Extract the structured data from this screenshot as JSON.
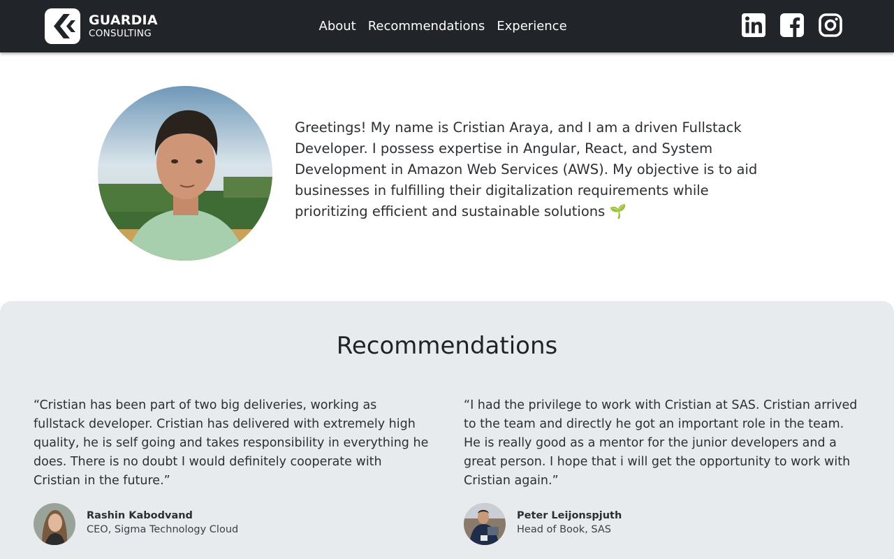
{
  "header": {
    "brand": {
      "line1": "GUARDIA",
      "line2": "CONSULTING"
    },
    "nav": [
      {
        "label": "About"
      },
      {
        "label": "Recommendations"
      },
      {
        "label": "Experience"
      }
    ],
    "socials": [
      {
        "icon": "linkedin-icon"
      },
      {
        "icon": "facebook-icon"
      },
      {
        "icon": "instagram-icon"
      }
    ]
  },
  "about": {
    "intro": "Greetings! My name is Cristian Araya, and I am a driven Fullstack Developer. I possess expertise in Angular, React, and System Development in Amazon Web Services (AWS). My objective is to aid businesses in fulfilling their digitalization requirements while prioritizing efficient and sustainable solutions 🌱"
  },
  "recommendations": {
    "title": "Recommendations",
    "items": [
      {
        "quote": "“Cristian has been part of two big deliveries, working as fullstack developer. Cristian has delivered with extremely high quality, he is self going and takes responsibility in everything he does. There is no doubt I would definitely cooperate with Cristian in the future.”",
        "name": "Rashin Kabodvand",
        "role": "CEO, Sigma Technology Cloud"
      },
      {
        "quote": "“I had the privilege to work with Cristian at SAS. Cristian arrived to the team and directly he got an important role in the team. He is really good as a mentor for the junior developers and a great person. I hope that i will get the opportunity to work with Cristian again.”",
        "name": "Peter Leijonspjuth",
        "role": "Head of Book, SAS"
      }
    ]
  },
  "colors": {
    "navbar": "#212429",
    "section_bg": "#e8ebee",
    "text": "#2b2f34"
  }
}
